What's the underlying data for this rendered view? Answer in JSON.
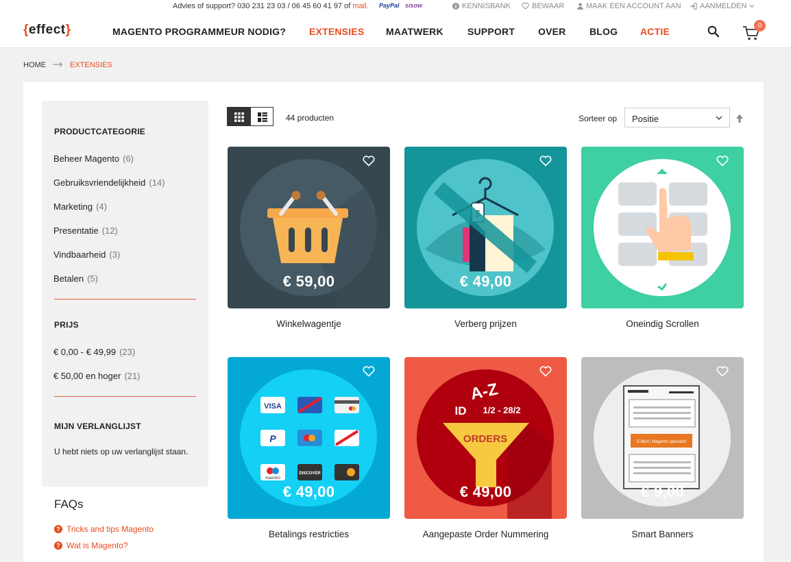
{
  "topbar": {
    "advice_prefix": "Advies of support? 030 231 23 03 / 06 45 60 41 97 of",
    "advice_mail": "mail.",
    "paypal": "PayPal",
    "sisow": "sisow",
    "links": [
      {
        "label": "KENNISBANK",
        "icon": "info-icon"
      },
      {
        "label": "BEWAAR",
        "icon": "heart-icon"
      },
      {
        "label": "MAAK EEN ACCOUNT AAN",
        "icon": "user-icon"
      },
      {
        "label": "AANMELDEN",
        "icon": "login-icon"
      }
    ]
  },
  "header": {
    "logo_open": "{",
    "logo_text": "effect",
    "logo_close": "}",
    "nav": [
      {
        "label": "MAGENTO PROGRAMMEUR NODIG?",
        "active": false
      },
      {
        "label": "EXTENSIES",
        "active": true
      },
      {
        "label": "MAATWERK",
        "active": false
      },
      {
        "label": "SUPPORT",
        "active": false
      },
      {
        "label": "OVER",
        "active": false
      },
      {
        "label": "BLOG",
        "active": false
      },
      {
        "label": "ACTIE",
        "active": true
      }
    ],
    "cart_count": "0"
  },
  "breadcrumb": {
    "home": "HOME",
    "current": "EXTENSIES"
  },
  "sidebar": {
    "category_title": "PRODUCTCATEGORIE",
    "categories": [
      {
        "label": "Beheer Magento",
        "count": "(6)"
      },
      {
        "label": "Gebruiksvriendelijkheid",
        "count": "(14)"
      },
      {
        "label": "Marketing",
        "count": "(4)"
      },
      {
        "label": "Presentatie",
        "count": "(12)"
      },
      {
        "label": "Vindbaarheid",
        "count": "(3)"
      },
      {
        "label": "Betalen",
        "count": "(5)"
      }
    ],
    "price_title": "PRIJS",
    "prices": [
      {
        "label": "€ 0,00 - € 49,99",
        "count": "(23)"
      },
      {
        "label": "€ 50,00 en hoger",
        "count": "(21)"
      }
    ],
    "wishlist_title": "MIJN VERLANGLIJST",
    "wishlist_text": "U hebt niets op uw verlanglijst staan.",
    "faq_title": "FAQs",
    "faqs": [
      "Tricks and tips Magento",
      "Wat is Magento?"
    ]
  },
  "toolbar": {
    "count": "44 producten",
    "sort_label": "Sorteer op",
    "sort_value": "Positie"
  },
  "products": [
    {
      "name": "Winkelwagentje",
      "price": "€ 59,00",
      "bg": "#37474f",
      "circle": "#455a64"
    },
    {
      "name": "Verberg prijzen",
      "price": "€ 49,00",
      "bg": "#14959a",
      "circle": "#4ec3c9"
    },
    {
      "name": "Oneindig Scrollen",
      "price": "",
      "bg": "#3ecfa2",
      "circle": "#ffffff"
    },
    {
      "name": "Betalings restricties",
      "price": "€ 49,00",
      "bg": "#03a9d4",
      "circle": "#14d0f5"
    },
    {
      "name": "Aangepaste Order Nummering",
      "price": "€ 49,00",
      "bg": "#ee5a44",
      "circle": "#b0000e"
    },
    {
      "name": "Smart Banners",
      "price": "€ 9,00",
      "bg": "#bdbdbd",
      "circle": "#eeeeee"
    }
  ],
  "art_text": {
    "orders": "ORDERS",
    "az": "A-Z",
    "id": "ID",
    "date": "1/2 - 28/2",
    "banner": "E-ffect | Magento specialist",
    "visa": "VISA",
    "discover": "DISCOVER",
    "maestro": "maestro",
    "dollar": "$"
  },
  "colors": {
    "accent": "#e84c1e",
    "dark": "#333333"
  }
}
